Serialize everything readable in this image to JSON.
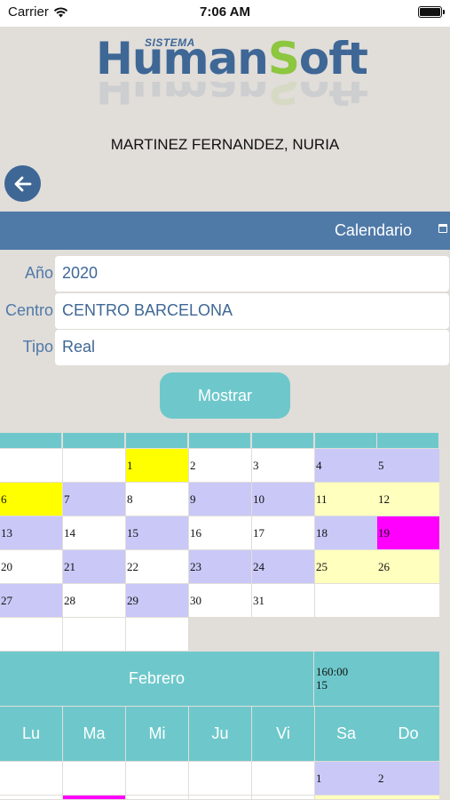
{
  "status_bar": {
    "carrier": "Carrier",
    "time": "7:06 AM"
  },
  "logo": {
    "prefix": "SISTEMA",
    "human": "Human",
    "s": "S",
    "oft": "oft",
    "colors": {
      "blue": "#3e6796",
      "green": "#8dc63f"
    }
  },
  "user": {
    "name": "MARTINEZ FERNANDEZ, NURIA"
  },
  "header": {
    "title": "Calendario",
    "icon": "calendar-icon",
    "bar_color": "#4f7aa8"
  },
  "form": {
    "year_label": "Año",
    "year_value": "2020",
    "center_label": "Centro",
    "center_value": "CENTRO BARCELONA",
    "type_label": "Tipo",
    "type_value": "Real"
  },
  "show_button": {
    "label": "Mostrar",
    "color": "#6ec8cb"
  },
  "january": {
    "rows": [
      [
        {
          "d": "",
          "c": "w"
        },
        {
          "d": "",
          "c": "w"
        },
        {
          "d": "1",
          "c": "yel"
        },
        {
          "d": "2",
          "c": "w"
        },
        {
          "d": "3",
          "c": "w"
        },
        {
          "d": "4",
          "c": "lav"
        },
        {
          "d": "5",
          "c": "lav"
        }
      ],
      [
        {
          "d": "6",
          "c": "yel"
        },
        {
          "d": "7",
          "c": "lav"
        },
        {
          "d": "8",
          "c": "w"
        },
        {
          "d": "9",
          "c": "lav"
        },
        {
          "d": "10",
          "c": "lav"
        },
        {
          "d": "11",
          "c": "pyel"
        },
        {
          "d": "12",
          "c": "pyel"
        }
      ],
      [
        {
          "d": "13",
          "c": "lav"
        },
        {
          "d": "14",
          "c": "w"
        },
        {
          "d": "15",
          "c": "lav"
        },
        {
          "d": "16",
          "c": "w"
        },
        {
          "d": "17",
          "c": "w"
        },
        {
          "d": "18",
          "c": "lav"
        },
        {
          "d": "19",
          "c": "mag"
        }
      ],
      [
        {
          "d": "20",
          "c": "w"
        },
        {
          "d": "21",
          "c": "lav"
        },
        {
          "d": "22",
          "c": "w"
        },
        {
          "d": "23",
          "c": "lav"
        },
        {
          "d": "24",
          "c": "lav"
        },
        {
          "d": "25",
          "c": "pyel"
        },
        {
          "d": "26",
          "c": "pyel"
        }
      ],
      [
        {
          "d": "27",
          "c": "lav"
        },
        {
          "d": "28",
          "c": "w"
        },
        {
          "d": "29",
          "c": "lav"
        },
        {
          "d": "30",
          "c": "w"
        },
        {
          "d": "31",
          "c": "w"
        },
        {
          "d": "",
          "c": "w"
        },
        {
          "d": "",
          "c": "w"
        }
      ],
      [
        {
          "d": "",
          "c": "w"
        },
        {
          "d": "",
          "c": "w"
        },
        {
          "d": "",
          "c": "w"
        }
      ]
    ]
  },
  "february": {
    "month": "Febrero",
    "hours": "160:00",
    "days_count": "15",
    "weekdays": [
      "Lu",
      "Ma",
      "Mi",
      "Ju",
      "Vi",
      "Sa",
      "Do"
    ],
    "rows": [
      [
        {
          "d": "",
          "c": "w"
        },
        {
          "d": "",
          "c": "w"
        },
        {
          "d": "",
          "c": "w"
        },
        {
          "d": "",
          "c": "w"
        },
        {
          "d": "",
          "c": "w"
        },
        {
          "d": "1",
          "c": "lav"
        },
        {
          "d": "2",
          "c": "lav"
        }
      ],
      [
        {
          "d": "",
          "c": "w"
        },
        {
          "d": "",
          "c": "mag"
        },
        {
          "d": "",
          "c": "w"
        },
        {
          "d": "",
          "c": "w"
        },
        {
          "d": "",
          "c": "w"
        },
        {
          "d": "",
          "c": "pyel"
        },
        {
          "d": "",
          "c": "pyel"
        }
      ]
    ]
  },
  "legend_colors": {
    "white": "#ffffff",
    "lavender": "#c9c8f7",
    "yellow": "#ffff00",
    "pale_yellow": "#ffffbe",
    "magenta": "#ff00ff",
    "teal": "#6ec8cb"
  }
}
